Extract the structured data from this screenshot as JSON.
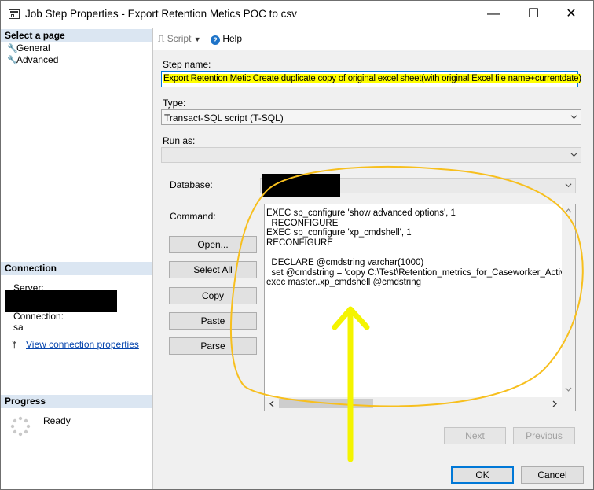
{
  "window": {
    "title": "Job Step Properties - Export Retention Metics POC to csv",
    "minimize_glyph": "—",
    "maximize_glyph": "☐",
    "close_glyph": "✕"
  },
  "sidebar": {
    "select_page_header": "Select a page",
    "pages": [
      {
        "label": "General",
        "icon": "wrench-icon"
      },
      {
        "label": "Advanced",
        "icon": "wrench-icon"
      }
    ],
    "connection_header": "Connection",
    "server_label": "Server:",
    "connection_label": "Connection:",
    "connection_value": "sa",
    "view_connection_link": "View connection properties",
    "progress_header": "Progress",
    "progress_status": "Ready"
  },
  "toolbar": {
    "script_label": "Script",
    "help_label": "Help"
  },
  "form": {
    "step_name_label": "Step name:",
    "step_name_value": "Export Retention Metic Create duplicate copy of original excel sheet(with original Excel file name+currentdate)",
    "type_label": "Type:",
    "type_value": "Transact-SQL script (T-SQL)",
    "run_as_label": "Run as:",
    "run_as_value": "",
    "database_label": "Database:",
    "command_label": "Command:",
    "command_lines": [
      "EXEC sp_configure 'show advanced options', 1",
      "  RECONFIGURE",
      "EXEC sp_configure 'xp_cmdshell', 1",
      "RECONFIGURE",
      "",
      "  DECLARE @cmdstring varchar(1000)",
      "  set @cmdstring = 'copy C:\\Test\\Retention_metrics_for_Caseworker_Activity.x",
      "exec master..xp_cmdshell @cmdstring"
    ],
    "open_button": "Open...",
    "select_all_button": "Select All",
    "copy_button": "Copy",
    "paste_button": "Paste",
    "parse_button": "Parse",
    "next_button": "Next",
    "previous_button": "Previous"
  },
  "footer": {
    "ok_button": "OK",
    "cancel_button": "Cancel"
  },
  "colors": {
    "highlight": "#ffff00",
    "annotation_circle": "#f7bf1e",
    "annotation_arrow": "#f4f400",
    "section_header": "#dbe6f2",
    "link": "#0645ad"
  }
}
